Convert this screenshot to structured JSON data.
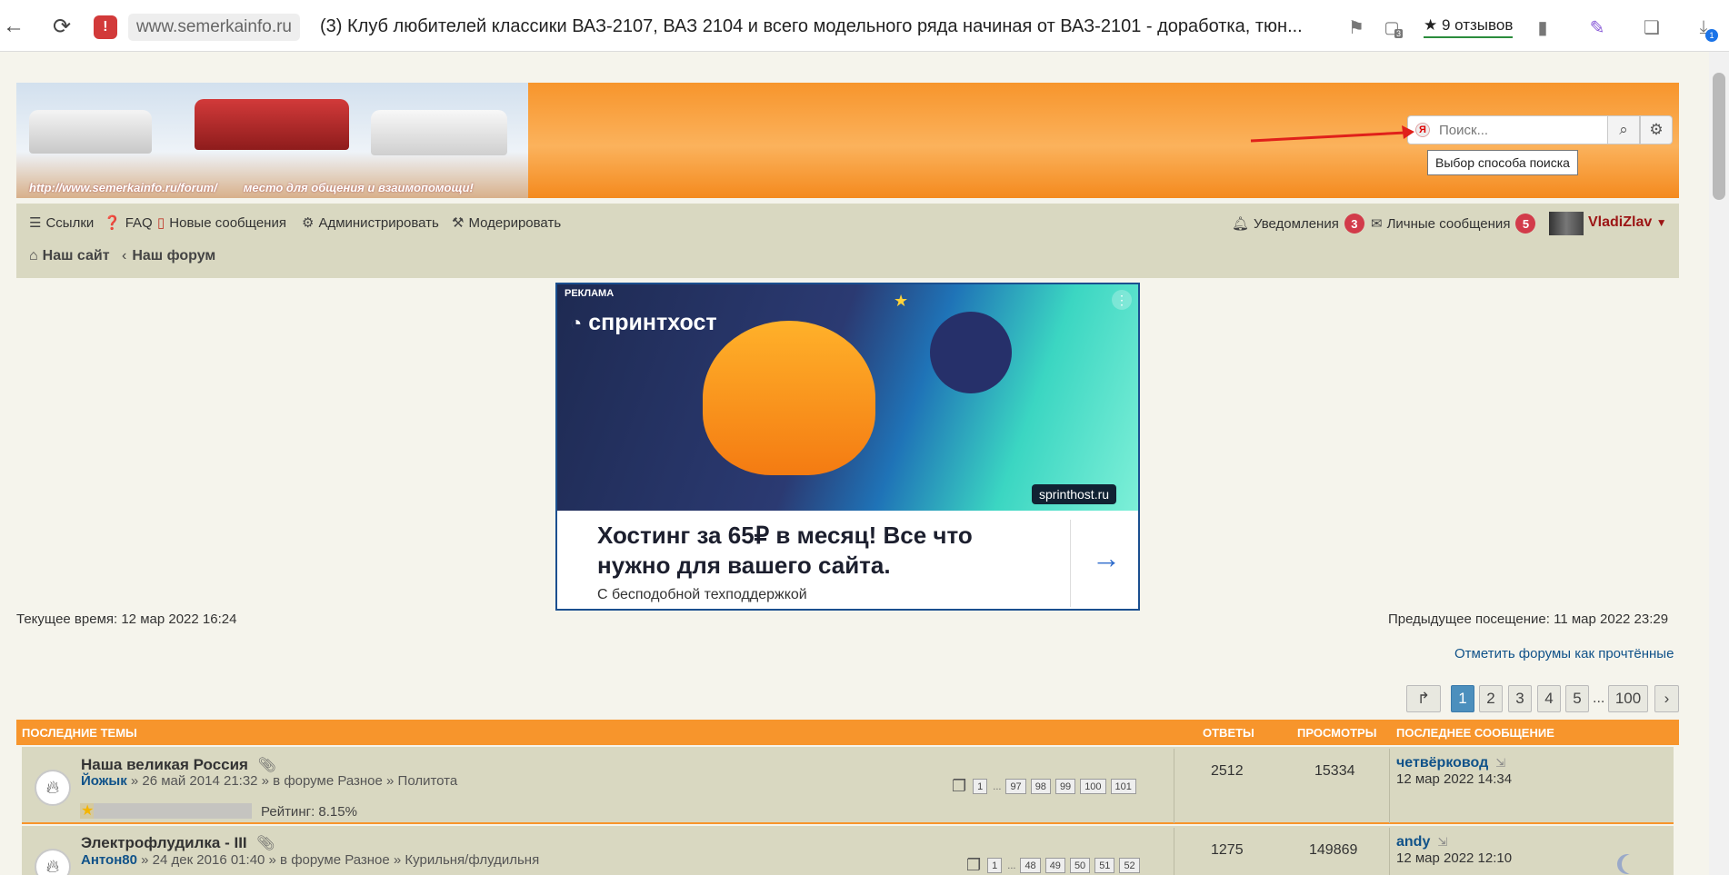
{
  "browser": {
    "domain": "www.semerkainfo.ru",
    "tab_title": "(3) Клуб любителей классики ВАЗ-2107, ВАЗ 2104 и всего модельного ряда начиная от ВАЗ-2101 - доработка, тюн...",
    "reviews": "★ 9 отзывов",
    "tab_count": "3",
    "download_count": "1"
  },
  "header": {
    "banner_url": "http://www.semerkainfo.ru/forum/",
    "banner_slogan": "место для общения и взаимопомощи!",
    "search_placeholder": "Поиск...",
    "search_tooltip": "Выбор способа поиска"
  },
  "nav": {
    "links": "Ссылки",
    "faq": "FAQ",
    "new_posts": "Новые сообщения",
    "admin": "Администрировать",
    "moderate": "Модерировать",
    "notifications": "Уведомления",
    "notifications_count": "3",
    "pm": "Личные сообщения",
    "pm_count": "5",
    "username": "VladiZlav"
  },
  "breadcrumb": {
    "site": "Наш сайт",
    "forum": "Наш форум"
  },
  "ad": {
    "label": "РЕКЛАМА",
    "brand": "спринтхост",
    "badge": "sprinthost.ru",
    "headline": "Хостинг за 65₽ в месяц! Все что нужно для вашего сайта.",
    "subtext": "С бесподобной техподдержкой"
  },
  "status": {
    "current_time": "Текущее время: 12 мар 2022 16:24",
    "previous_visit": "Предыдущее посещение: 11 мар 2022 23:29",
    "mark_read": "Отметить форумы как прочтённые"
  },
  "pagination": [
    "1",
    "2",
    "3",
    "4",
    "5",
    "...",
    "100"
  ],
  "table": {
    "headers": {
      "topics": "ПОСЛЕДНИЕ ТЕМЫ",
      "replies": "ОТВЕТЫ",
      "views": "ПРОСМОТРЫ",
      "last_post": "ПОСЛЕДНЕЕ СООБЩЕНИЕ"
    },
    "rows": [
      {
        "title": "Наша великая Россия",
        "author": "Йожык",
        "meta": " » 26 май 2014 21:32 » в форуме Разное » Политота",
        "pages": [
          "1",
          "...",
          "97",
          "98",
          "99",
          "100",
          "101"
        ],
        "rating": "Рейтинг: 8.15%",
        "rating_level": 0.0815,
        "replies": "2512",
        "views": "15334",
        "last_user": "четвёрковод",
        "last_time": "12 мар 2022 14:34"
      },
      {
        "title": "Электрофлудилка - III",
        "author": "Антон80",
        "meta": " » 24 дек 2016 01:40 » в форуме Разное » Курильня/флудильня",
        "pages": [
          "1",
          "...",
          "48",
          "49",
          "50",
          "51",
          "52"
        ],
        "replies": "1275",
        "views": "149869",
        "last_user": "andy",
        "last_time": "12 мар 2022 12:10"
      }
    ]
  }
}
